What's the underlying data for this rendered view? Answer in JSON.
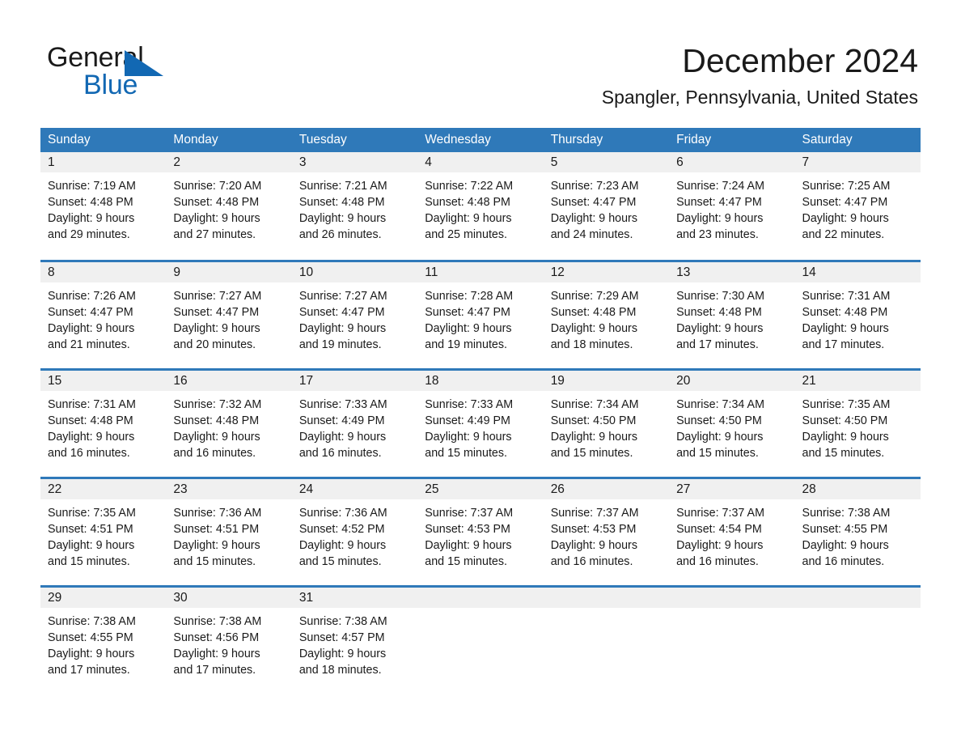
{
  "brand": {
    "line1": "General",
    "line2": "Blue",
    "mark": "triangle-logo",
    "accent_color": "#1268b3"
  },
  "header": {
    "title": "December 2024",
    "location": "Spangler, Pennsylvania, United States"
  },
  "theme": {
    "header_blue": "#2f79b9",
    "daynum_gray": "#f0f0f0",
    "text_dark": "#1a1a1a"
  },
  "weekdays": [
    "Sunday",
    "Monday",
    "Tuesday",
    "Wednesday",
    "Thursday",
    "Friday",
    "Saturday"
  ],
  "labels": {
    "sunrise_prefix": "Sunrise:",
    "sunset_prefix": "Sunset:",
    "daylight_prefix": "Daylight:"
  },
  "weeks": [
    [
      {
        "day": "1",
        "sunrise": "Sunrise: 7:19 AM",
        "sunset": "Sunset: 4:48 PM",
        "daylight_1": "Daylight: 9 hours",
        "daylight_2": "and 29 minutes."
      },
      {
        "day": "2",
        "sunrise": "Sunrise: 7:20 AM",
        "sunset": "Sunset: 4:48 PM",
        "daylight_1": "Daylight: 9 hours",
        "daylight_2": "and 27 minutes."
      },
      {
        "day": "3",
        "sunrise": "Sunrise: 7:21 AM",
        "sunset": "Sunset: 4:48 PM",
        "daylight_1": "Daylight: 9 hours",
        "daylight_2": "and 26 minutes."
      },
      {
        "day": "4",
        "sunrise": "Sunrise: 7:22 AM",
        "sunset": "Sunset: 4:48 PM",
        "daylight_1": "Daylight: 9 hours",
        "daylight_2": "and 25 minutes."
      },
      {
        "day": "5",
        "sunrise": "Sunrise: 7:23 AM",
        "sunset": "Sunset: 4:47 PM",
        "daylight_1": "Daylight: 9 hours",
        "daylight_2": "and 24 minutes."
      },
      {
        "day": "6",
        "sunrise": "Sunrise: 7:24 AM",
        "sunset": "Sunset: 4:47 PM",
        "daylight_1": "Daylight: 9 hours",
        "daylight_2": "and 23 minutes."
      },
      {
        "day": "7",
        "sunrise": "Sunrise: 7:25 AM",
        "sunset": "Sunset: 4:47 PM",
        "daylight_1": "Daylight: 9 hours",
        "daylight_2": "and 22 minutes."
      }
    ],
    [
      {
        "day": "8",
        "sunrise": "Sunrise: 7:26 AM",
        "sunset": "Sunset: 4:47 PM",
        "daylight_1": "Daylight: 9 hours",
        "daylight_2": "and 21 minutes."
      },
      {
        "day": "9",
        "sunrise": "Sunrise: 7:27 AM",
        "sunset": "Sunset: 4:47 PM",
        "daylight_1": "Daylight: 9 hours",
        "daylight_2": "and 20 minutes."
      },
      {
        "day": "10",
        "sunrise": "Sunrise: 7:27 AM",
        "sunset": "Sunset: 4:47 PM",
        "daylight_1": "Daylight: 9 hours",
        "daylight_2": "and 19 minutes."
      },
      {
        "day": "11",
        "sunrise": "Sunrise: 7:28 AM",
        "sunset": "Sunset: 4:47 PM",
        "daylight_1": "Daylight: 9 hours",
        "daylight_2": "and 19 minutes."
      },
      {
        "day": "12",
        "sunrise": "Sunrise: 7:29 AM",
        "sunset": "Sunset: 4:48 PM",
        "daylight_1": "Daylight: 9 hours",
        "daylight_2": "and 18 minutes."
      },
      {
        "day": "13",
        "sunrise": "Sunrise: 7:30 AM",
        "sunset": "Sunset: 4:48 PM",
        "daylight_1": "Daylight: 9 hours",
        "daylight_2": "and 17 minutes."
      },
      {
        "day": "14",
        "sunrise": "Sunrise: 7:31 AM",
        "sunset": "Sunset: 4:48 PM",
        "daylight_1": "Daylight: 9 hours",
        "daylight_2": "and 17 minutes."
      }
    ],
    [
      {
        "day": "15",
        "sunrise": "Sunrise: 7:31 AM",
        "sunset": "Sunset: 4:48 PM",
        "daylight_1": "Daylight: 9 hours",
        "daylight_2": "and 16 minutes."
      },
      {
        "day": "16",
        "sunrise": "Sunrise: 7:32 AM",
        "sunset": "Sunset: 4:48 PM",
        "daylight_1": "Daylight: 9 hours",
        "daylight_2": "and 16 minutes."
      },
      {
        "day": "17",
        "sunrise": "Sunrise: 7:33 AM",
        "sunset": "Sunset: 4:49 PM",
        "daylight_1": "Daylight: 9 hours",
        "daylight_2": "and 16 minutes."
      },
      {
        "day": "18",
        "sunrise": "Sunrise: 7:33 AM",
        "sunset": "Sunset: 4:49 PM",
        "daylight_1": "Daylight: 9 hours",
        "daylight_2": "and 15 minutes."
      },
      {
        "day": "19",
        "sunrise": "Sunrise: 7:34 AM",
        "sunset": "Sunset: 4:50 PM",
        "daylight_1": "Daylight: 9 hours",
        "daylight_2": "and 15 minutes."
      },
      {
        "day": "20",
        "sunrise": "Sunrise: 7:34 AM",
        "sunset": "Sunset: 4:50 PM",
        "daylight_1": "Daylight: 9 hours",
        "daylight_2": "and 15 minutes."
      },
      {
        "day": "21",
        "sunrise": "Sunrise: 7:35 AM",
        "sunset": "Sunset: 4:50 PM",
        "daylight_1": "Daylight: 9 hours",
        "daylight_2": "and 15 minutes."
      }
    ],
    [
      {
        "day": "22",
        "sunrise": "Sunrise: 7:35 AM",
        "sunset": "Sunset: 4:51 PM",
        "daylight_1": "Daylight: 9 hours",
        "daylight_2": "and 15 minutes."
      },
      {
        "day": "23",
        "sunrise": "Sunrise: 7:36 AM",
        "sunset": "Sunset: 4:51 PM",
        "daylight_1": "Daylight: 9 hours",
        "daylight_2": "and 15 minutes."
      },
      {
        "day": "24",
        "sunrise": "Sunrise: 7:36 AM",
        "sunset": "Sunset: 4:52 PM",
        "daylight_1": "Daylight: 9 hours",
        "daylight_2": "and 15 minutes."
      },
      {
        "day": "25",
        "sunrise": "Sunrise: 7:37 AM",
        "sunset": "Sunset: 4:53 PM",
        "daylight_1": "Daylight: 9 hours",
        "daylight_2": "and 15 minutes."
      },
      {
        "day": "26",
        "sunrise": "Sunrise: 7:37 AM",
        "sunset": "Sunset: 4:53 PM",
        "daylight_1": "Daylight: 9 hours",
        "daylight_2": "and 16 minutes."
      },
      {
        "day": "27",
        "sunrise": "Sunrise: 7:37 AM",
        "sunset": "Sunset: 4:54 PM",
        "daylight_1": "Daylight: 9 hours",
        "daylight_2": "and 16 minutes."
      },
      {
        "day": "28",
        "sunrise": "Sunrise: 7:38 AM",
        "sunset": "Sunset: 4:55 PM",
        "daylight_1": "Daylight: 9 hours",
        "daylight_2": "and 16 minutes."
      }
    ],
    [
      {
        "day": "29",
        "sunrise": "Sunrise: 7:38 AM",
        "sunset": "Sunset: 4:55 PM",
        "daylight_1": "Daylight: 9 hours",
        "daylight_2": "and 17 minutes."
      },
      {
        "day": "30",
        "sunrise": "Sunrise: 7:38 AM",
        "sunset": "Sunset: 4:56 PM",
        "daylight_1": "Daylight: 9 hours",
        "daylight_2": "and 17 minutes."
      },
      {
        "day": "31",
        "sunrise": "Sunrise: 7:38 AM",
        "sunset": "Sunset: 4:57 PM",
        "daylight_1": "Daylight: 9 hours",
        "daylight_2": "and 18 minutes."
      },
      {
        "day": "",
        "sunrise": "",
        "sunset": "",
        "daylight_1": "",
        "daylight_2": ""
      },
      {
        "day": "",
        "sunrise": "",
        "sunset": "",
        "daylight_1": "",
        "daylight_2": ""
      },
      {
        "day": "",
        "sunrise": "",
        "sunset": "",
        "daylight_1": "",
        "daylight_2": ""
      },
      {
        "day": "",
        "sunrise": "",
        "sunset": "",
        "daylight_1": "",
        "daylight_2": ""
      }
    ]
  ]
}
